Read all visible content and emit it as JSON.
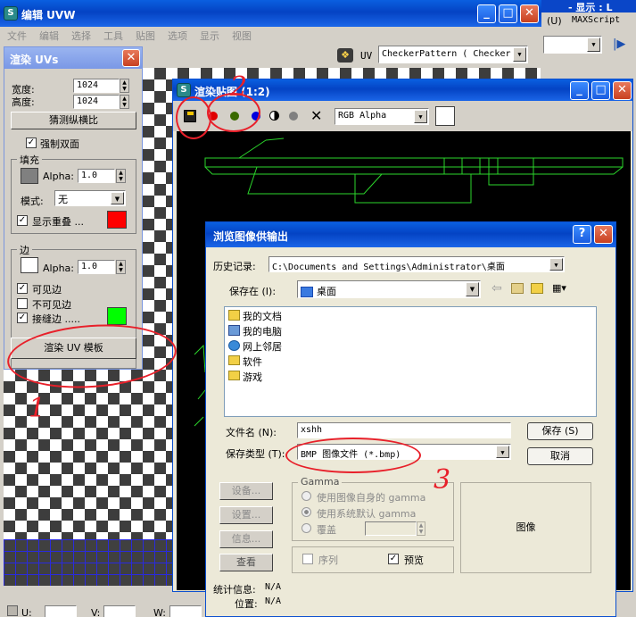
{
  "uv_editor": {
    "title": "编辑 UVW",
    "menu": [
      "文件",
      "编辑",
      "选择",
      "工具",
      "贴图",
      "选项",
      "显示",
      "视图"
    ],
    "uv_label": "UV",
    "texture_select": "CheckerPattern  ( Checker"
  },
  "right_app": {
    "title": "- 显示 : L",
    "menu_u": "U",
    "menu_u_key": "U",
    "menu_maxscript": "MAXScript",
    "menu_maxscript_key": "M"
  },
  "render_uvs": {
    "title": "渲染 UVs",
    "width_label": "宽度:",
    "width_value": "1024",
    "height_label": "高度:",
    "height_value": "1024",
    "guess_aspect": "猜测纵横比",
    "force_2sided": "强制双面",
    "fill_group": "填充",
    "alpha_label": "Alpha:",
    "fill_alpha": "1.0",
    "mode_label": "模式:",
    "mode_value": "无",
    "show_overlap": "显示重叠 ...",
    "edge_group": "边",
    "edge_alpha": "1.0",
    "visible_edges": "可见边",
    "invisible_edges": "不可见边",
    "seam_edges": "接缝边 .....",
    "render_button": "渲染 UV 模板"
  },
  "render_map": {
    "title": "渲染贴图  (1:2)",
    "channel": "RGB Alpha"
  },
  "bottom_bar": {
    "u": "U:",
    "v": "V:",
    "w": "W:"
  },
  "save_dialog": {
    "title": "浏览图像供输出",
    "history_label": "历史记录:",
    "history_value": "C:\\Documents and Settings\\Administrator\\桌面",
    "save_in_label": "保存在 (I):",
    "save_in_value": "桌面",
    "files": [
      {
        "name": "我的文档",
        "icon": "my-documents-icon"
      },
      {
        "name": "我的电脑",
        "icon": "my-computer-icon"
      },
      {
        "name": "网上邻居",
        "icon": "network-places-icon"
      },
      {
        "name": "软件",
        "icon": "folder-icon"
      },
      {
        "name": "游戏",
        "icon": "folder-icon"
      }
    ],
    "filename_label": "文件名 (N):",
    "filename_value": "xshh",
    "filetype_label": "保存类型 (T):",
    "filetype_value": "BMP 图像文件 (*.bmp)",
    "save_button": "保存 (S)",
    "cancel_button": "取消",
    "setup_button": "设备...",
    "settings_button": "设置...",
    "info_button": "信息...",
    "view_button": "查看",
    "gamma_group": "Gamma",
    "gamma_own": "使用图像自身的 gamma",
    "gamma_default": "使用系统默认 gamma",
    "gamma_override": "覆盖",
    "sequence_label": "序列",
    "preview_label": "预览",
    "image_label": "图像",
    "stats_label": "统计信息:",
    "stats_value": "N/A",
    "location_label": "位置:",
    "location_value": "N/A"
  },
  "annotations": [
    "1",
    "2",
    "3"
  ],
  "colors": {
    "xp_blue": "#0a5fe0",
    "overlap_swatch": "#ff0000",
    "seam_swatch": "#00ff00",
    "fill_swatch": "#808080",
    "annotation_red": "#e8202a",
    "wire_green": "#2bd62b"
  }
}
